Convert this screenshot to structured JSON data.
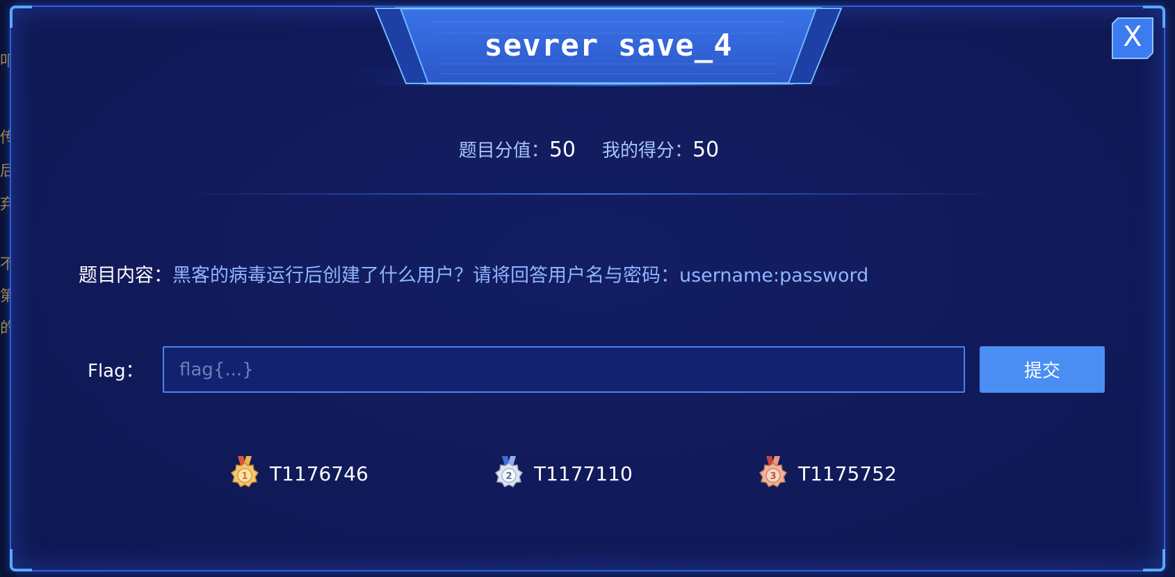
{
  "modal": {
    "title": "sevrer save_4",
    "close_label": "X"
  },
  "score": {
    "value_label": "题目分值：",
    "value": "50",
    "mine_label": "我的得分：",
    "mine": "50"
  },
  "question": {
    "label": "题目内容：",
    "text": "黑客的病毒运行后创建了什么用户？请将回答用户名与密码：username:password"
  },
  "flag": {
    "label": "Flag：",
    "placeholder": "flag{...}",
    "value": "",
    "submit_label": "提交"
  },
  "ranking": [
    {
      "rank": "1",
      "name": "T1176746",
      "medal": "gold-medal-icon",
      "color": "#e8a23a"
    },
    {
      "rank": "2",
      "name": "T1177110",
      "medal": "silver-medal-icon",
      "color": "#b9c6dc"
    },
    {
      "rank": "3",
      "name": "T1175752",
      "medal": "bronze-medal-icon",
      "color": "#e0856a"
    }
  ],
  "background": {
    "partial_text": [
      "叩",
      "传",
      "后",
      "弃",
      "不",
      "第",
      "的"
    ]
  },
  "colors": {
    "modal_bg": "#111a5a",
    "accent": "#4a8ef4",
    "border": "#2f5fd6",
    "question_text": "#8fb6ff"
  }
}
